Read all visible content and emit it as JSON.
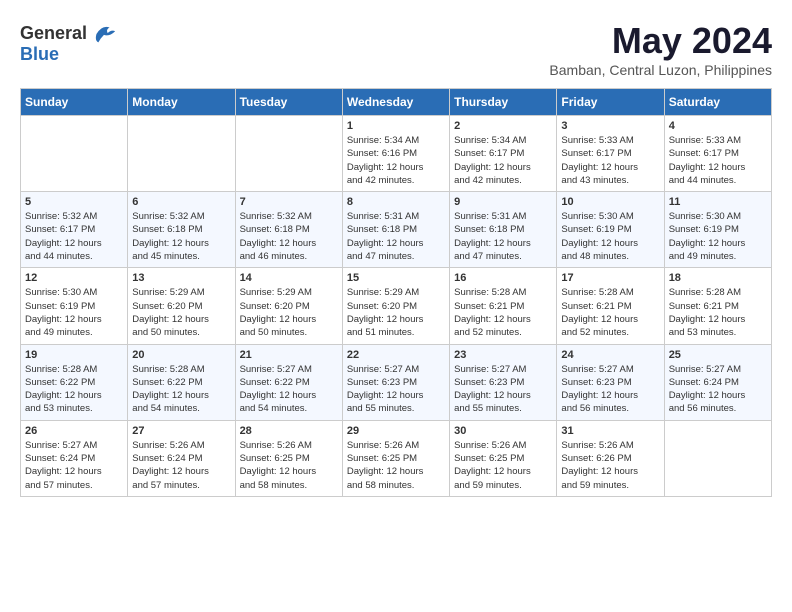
{
  "header": {
    "logo_line1": "General",
    "logo_line2": "Blue",
    "month_title": "May 2024",
    "subtitle": "Bamban, Central Luzon, Philippines"
  },
  "weekdays": [
    "Sunday",
    "Monday",
    "Tuesday",
    "Wednesday",
    "Thursday",
    "Friday",
    "Saturday"
  ],
  "weeks": [
    [
      {
        "day": "",
        "info": ""
      },
      {
        "day": "",
        "info": ""
      },
      {
        "day": "",
        "info": ""
      },
      {
        "day": "1",
        "info": "Sunrise: 5:34 AM\nSunset: 6:16 PM\nDaylight: 12 hours\nand 42 minutes."
      },
      {
        "day": "2",
        "info": "Sunrise: 5:34 AM\nSunset: 6:17 PM\nDaylight: 12 hours\nand 42 minutes."
      },
      {
        "day": "3",
        "info": "Sunrise: 5:33 AM\nSunset: 6:17 PM\nDaylight: 12 hours\nand 43 minutes."
      },
      {
        "day": "4",
        "info": "Sunrise: 5:33 AM\nSunset: 6:17 PM\nDaylight: 12 hours\nand 44 minutes."
      }
    ],
    [
      {
        "day": "5",
        "info": "Sunrise: 5:32 AM\nSunset: 6:17 PM\nDaylight: 12 hours\nand 44 minutes."
      },
      {
        "day": "6",
        "info": "Sunrise: 5:32 AM\nSunset: 6:18 PM\nDaylight: 12 hours\nand 45 minutes."
      },
      {
        "day": "7",
        "info": "Sunrise: 5:32 AM\nSunset: 6:18 PM\nDaylight: 12 hours\nand 46 minutes."
      },
      {
        "day": "8",
        "info": "Sunrise: 5:31 AM\nSunset: 6:18 PM\nDaylight: 12 hours\nand 47 minutes."
      },
      {
        "day": "9",
        "info": "Sunrise: 5:31 AM\nSunset: 6:18 PM\nDaylight: 12 hours\nand 47 minutes."
      },
      {
        "day": "10",
        "info": "Sunrise: 5:30 AM\nSunset: 6:19 PM\nDaylight: 12 hours\nand 48 minutes."
      },
      {
        "day": "11",
        "info": "Sunrise: 5:30 AM\nSunset: 6:19 PM\nDaylight: 12 hours\nand 49 minutes."
      }
    ],
    [
      {
        "day": "12",
        "info": "Sunrise: 5:30 AM\nSunset: 6:19 PM\nDaylight: 12 hours\nand 49 minutes."
      },
      {
        "day": "13",
        "info": "Sunrise: 5:29 AM\nSunset: 6:20 PM\nDaylight: 12 hours\nand 50 minutes."
      },
      {
        "day": "14",
        "info": "Sunrise: 5:29 AM\nSunset: 6:20 PM\nDaylight: 12 hours\nand 50 minutes."
      },
      {
        "day": "15",
        "info": "Sunrise: 5:29 AM\nSunset: 6:20 PM\nDaylight: 12 hours\nand 51 minutes."
      },
      {
        "day": "16",
        "info": "Sunrise: 5:28 AM\nSunset: 6:21 PM\nDaylight: 12 hours\nand 52 minutes."
      },
      {
        "day": "17",
        "info": "Sunrise: 5:28 AM\nSunset: 6:21 PM\nDaylight: 12 hours\nand 52 minutes."
      },
      {
        "day": "18",
        "info": "Sunrise: 5:28 AM\nSunset: 6:21 PM\nDaylight: 12 hours\nand 53 minutes."
      }
    ],
    [
      {
        "day": "19",
        "info": "Sunrise: 5:28 AM\nSunset: 6:22 PM\nDaylight: 12 hours\nand 53 minutes."
      },
      {
        "day": "20",
        "info": "Sunrise: 5:28 AM\nSunset: 6:22 PM\nDaylight: 12 hours\nand 54 minutes."
      },
      {
        "day": "21",
        "info": "Sunrise: 5:27 AM\nSunset: 6:22 PM\nDaylight: 12 hours\nand 54 minutes."
      },
      {
        "day": "22",
        "info": "Sunrise: 5:27 AM\nSunset: 6:23 PM\nDaylight: 12 hours\nand 55 minutes."
      },
      {
        "day": "23",
        "info": "Sunrise: 5:27 AM\nSunset: 6:23 PM\nDaylight: 12 hours\nand 55 minutes."
      },
      {
        "day": "24",
        "info": "Sunrise: 5:27 AM\nSunset: 6:23 PM\nDaylight: 12 hours\nand 56 minutes."
      },
      {
        "day": "25",
        "info": "Sunrise: 5:27 AM\nSunset: 6:24 PM\nDaylight: 12 hours\nand 56 minutes."
      }
    ],
    [
      {
        "day": "26",
        "info": "Sunrise: 5:27 AM\nSunset: 6:24 PM\nDaylight: 12 hours\nand 57 minutes."
      },
      {
        "day": "27",
        "info": "Sunrise: 5:26 AM\nSunset: 6:24 PM\nDaylight: 12 hours\nand 57 minutes."
      },
      {
        "day": "28",
        "info": "Sunrise: 5:26 AM\nSunset: 6:25 PM\nDaylight: 12 hours\nand 58 minutes."
      },
      {
        "day": "29",
        "info": "Sunrise: 5:26 AM\nSunset: 6:25 PM\nDaylight: 12 hours\nand 58 minutes."
      },
      {
        "day": "30",
        "info": "Sunrise: 5:26 AM\nSunset: 6:25 PM\nDaylight: 12 hours\nand 59 minutes."
      },
      {
        "day": "31",
        "info": "Sunrise: 5:26 AM\nSunset: 6:26 PM\nDaylight: 12 hours\nand 59 minutes."
      },
      {
        "day": "",
        "info": ""
      }
    ]
  ]
}
